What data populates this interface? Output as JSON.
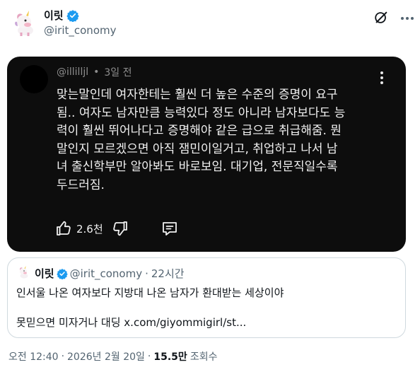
{
  "author": {
    "display_name": "이릿",
    "handle": "@irit_conomy"
  },
  "embedded_post": {
    "handle": "@illilljl",
    "time": "3일 전",
    "body": "맞는말인데 여자한테는 훨씬 더 높은 수준의 증명이 요구\n됨.. 여자도 남자만큼 능력있다 정도 아니라 남자보다도 능\n력이 훨씬 뛰어나다고 증명해야 같은 급으로 취급해줌. 뭔\n말인지 모르겠으면 아직 잼민이일거고, 취업하고 나서 남\n녀 출신학부만 알아봐도 바로보임. 대기업, 전문직일수록\n두드러짐.",
    "like_count": "2.6천"
  },
  "quote": {
    "display_name": "이릿",
    "handle": "@irit_conomy",
    "time": "22시간",
    "text_line1": "인서울 나온 여자보다 지방대 나온 남자가 환대받는 세상이야",
    "text_line2": "못믿으면 미자거나 대딩 x.com/giyommigirl/st..."
  },
  "footer": {
    "time": "오전 12:40",
    "date": "2026년 2월 20일",
    "views_count": "15.5만",
    "views_label": "조회수"
  },
  "colors": {
    "verified_blue": "#1d9bf0",
    "secondary_text": "#536471",
    "dark_card_bg": "#0d0d0d"
  },
  "icons": {
    "grok": "grok-icon",
    "more": "more-icon",
    "verified": "verified-badge-icon",
    "like": "thumbs-up-icon",
    "dislike": "thumbs-down-icon",
    "comment": "comment-icon"
  }
}
